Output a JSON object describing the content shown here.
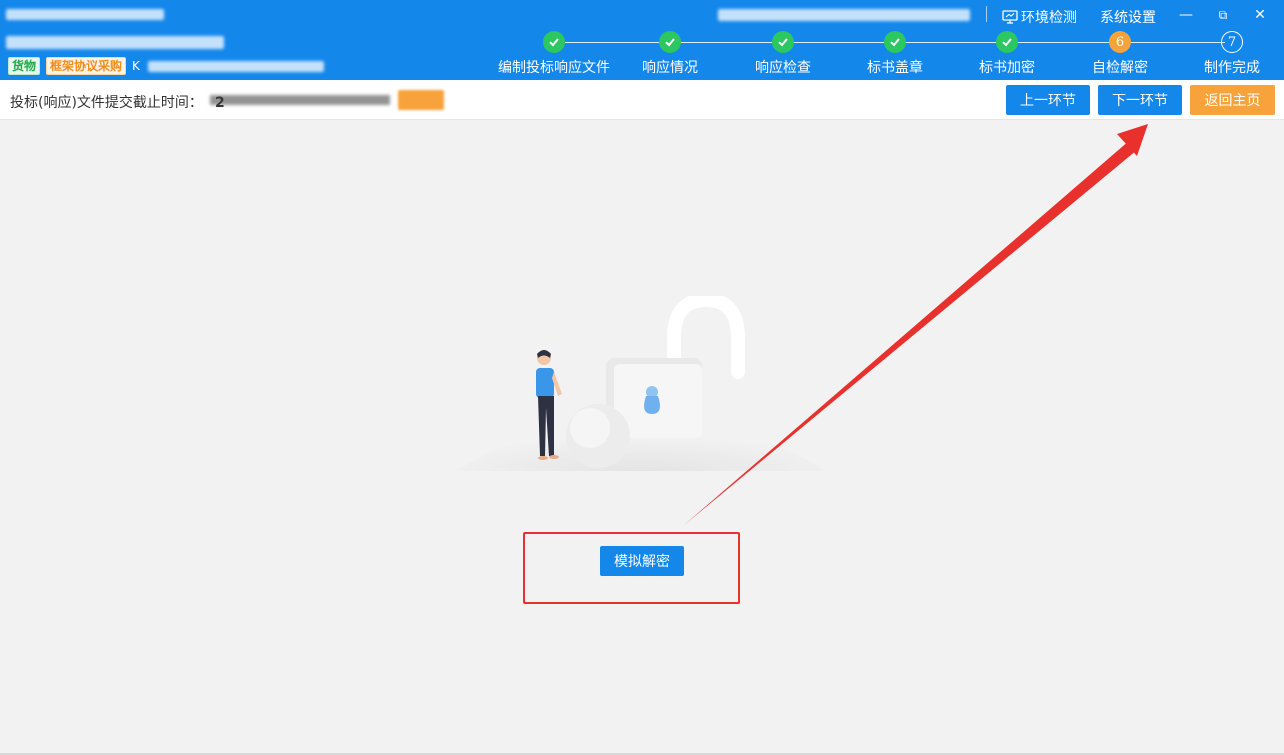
{
  "header": {
    "tags": {
      "category": "货物",
      "method": "框架协议采购",
      "code_prefix": "K"
    },
    "top_links": {
      "env_check": "环境检测",
      "settings": "系统设置"
    },
    "window_controls": {
      "minimize": "—",
      "restore": "⧉",
      "close": "✕"
    }
  },
  "steps": [
    {
      "label": "编制投标响应文件",
      "status": "done",
      "number": ""
    },
    {
      "label": "响应情况",
      "status": "done",
      "number": ""
    },
    {
      "label": "响应检查",
      "status": "done",
      "number": ""
    },
    {
      "label": "标书盖章",
      "status": "done",
      "number": ""
    },
    {
      "label": "标书加密",
      "status": "done",
      "number": ""
    },
    {
      "label": "自检解密",
      "status": "current",
      "number": "6"
    },
    {
      "label": "制作完成",
      "status": "todo",
      "number": "7"
    }
  ],
  "toolbar": {
    "deadline_label": "投标(响应)文件提交截止时间：",
    "deadline_prefix": "2",
    "prev_button": "上一环节",
    "next_button": "下一环节",
    "home_button": "返回主页"
  },
  "main": {
    "simulate_decrypt_button": "模拟解密"
  },
  "colors": {
    "header_bg": "#1487eb",
    "step_done": "#2cc760",
    "step_current": "#f7a23a",
    "button_primary": "#1487eb",
    "button_warning": "#f7a23a",
    "annotation": "#e8302c"
  }
}
